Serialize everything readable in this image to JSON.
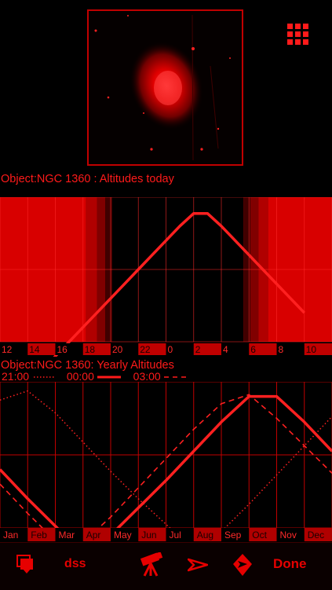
{
  "header": {
    "altitude_title": "Object:NGC 1360 : Altitudes today",
    "yearly_title": "Object:NGC 1360: Yearly Altitudes"
  },
  "legend": [
    {
      "time": "21:00",
      "style": "dotted"
    },
    {
      "time": "00:00",
      "style": "solid"
    },
    {
      "time": "03:00",
      "style": "dashed"
    }
  ],
  "toolbar": {
    "dss_label": "dss",
    "done_label": "Done"
  },
  "chart_data": [
    {
      "type": "line",
      "title": "Object:NGC 1360 : Altitudes today",
      "x_tick_labels": [
        "12",
        "14",
        "16",
        "18",
        "20",
        "22",
        "0",
        "2",
        "4",
        "6",
        "8",
        "10"
      ],
      "x_hours": [
        12,
        13,
        14,
        15,
        16,
        17,
        18,
        19,
        20,
        21,
        22,
        23,
        24,
        25,
        26,
        27,
        28,
        29,
        30,
        31,
        32,
        33,
        34
      ],
      "series": [
        {
          "values": [
            -40,
            -32,
            -24,
            -16,
            -8,
            0,
            8,
            16,
            24,
            32,
            40,
            48,
            56,
            64,
            71,
            71,
            64,
            56,
            48,
            40,
            32,
            24,
            16
          ]
        }
      ],
      "ylim": [
        0,
        80
      ],
      "grid": true,
      "background": "twilight shading: daylight bright red, night dark"
    },
    {
      "type": "line",
      "title": "Object:NGC 1360: Yearly Altitudes",
      "categories": [
        "Jan",
        "Feb",
        "Mar",
        "Apr",
        "May",
        "Jun",
        "Jul",
        "Aug",
        "Sep",
        "Oct",
        "Nov",
        "Dec"
      ],
      "series": [
        {
          "name": "21:00",
          "style": "dotted",
          "values": [
            70,
            75,
            63,
            47,
            31,
            16,
            2,
            -12,
            -2,
            13,
            29,
            45,
            61
          ]
        },
        {
          "name": "00:00",
          "style": "solid",
          "values": [
            32,
            16,
            1,
            -14,
            -4,
            11,
            26,
            42,
            58,
            72,
            72,
            58,
            42
          ]
        },
        {
          "name": "03:00",
          "style": "dashed",
          "values": [
            24,
            8,
            -7,
            -8,
            6,
            22,
            38,
            54,
            68,
            73,
            60,
            45,
            30
          ]
        }
      ],
      "ylim": [
        0,
        80
      ],
      "grid": true
    }
  ]
}
